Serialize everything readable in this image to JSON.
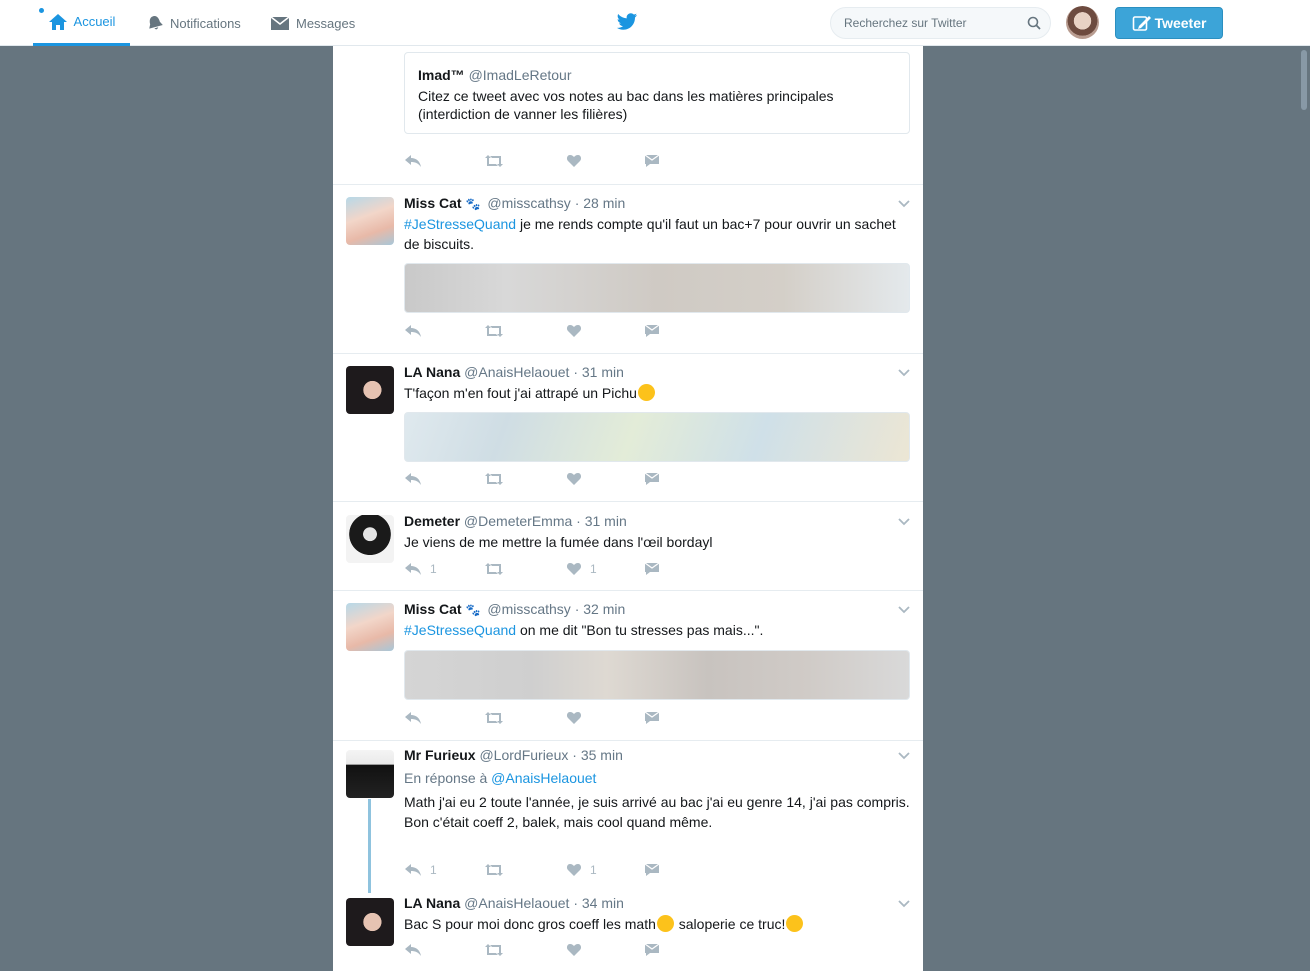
{
  "nav": {
    "home_label": "Accueil",
    "notifications_label": "Notifications",
    "messages_label": "Messages",
    "search_placeholder": "Recherchez sur Twitter",
    "tweet_button_label": "Tweeter",
    "accent_color": "#1b95e0"
  },
  "timeline": {
    "quote_tweet": {
      "name": "Imad™",
      "handle": "@ImadLeRetour",
      "text": "Citez ce tweet avec vos notes au bac dans les matières principales (interdiction de vanner les filières)"
    },
    "tweets": [
      {
        "name": "Miss Cat",
        "emoji": "🐾",
        "handle": "@misscathsy",
        "time": "· 28 min",
        "hashtag": "#JeStresseQuand",
        "text": " je me rends compte qu'il faut un bac+7 pour ouvrir un sachet de biscuits."
      },
      {
        "name": "LA Nana",
        "handle": "@AnaisHelaouet",
        "time": "· 31 min",
        "text": "T'façon m'en fout j'ai attrapé un Pichu"
      },
      {
        "name": "Demeter",
        "handle": "@DemeterEmma",
        "time": "· 31 min",
        "text": "Je viens de me mettre la fumée dans l'œil bordayl",
        "reply_count": "1",
        "like_count": "1"
      },
      {
        "name": "Miss Cat",
        "emoji": "🐾",
        "handle": "@misscathsy",
        "time": "· 32 min",
        "hashtag": "#JeStresseQuand",
        "text": " on me dit \"Bon tu stresses pas mais...\"."
      },
      {
        "name": "Mr Furieux",
        "handle": "@LordFurieux",
        "time": "· 35 min",
        "reply_prefix": "En réponse à ",
        "reply_mention": "@AnaisHelaouet",
        "text_line1": "Math j'ai eu 2 toute l'année, je suis arrivé au bac j'ai eu genre 14, j'ai pas compris.",
        "text_line2": "Bon c'était coeff 2, balek, mais cool quand même.",
        "reply_count": "1",
        "like_count": "1"
      },
      {
        "name": "LA Nana",
        "handle": "@AnaisHelaouet",
        "time": "· 34 min",
        "text_part1": "Bac S pour moi donc gros coeff les math",
        "text_part2": " saloperie ce truc!"
      }
    ]
  }
}
